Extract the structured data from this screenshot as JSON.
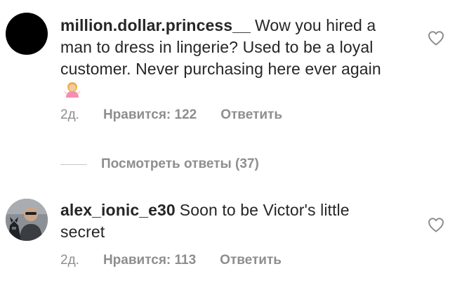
{
  "comments": [
    {
      "username": "million.dollar.princess__",
      "text": "Wow you hired a man to dress in lingerie? Used to be a loyal customer. Never purchasing here ever again",
      "emoji": "person-shrugging-emoji",
      "time": "2д.",
      "likes": "Нравится: 122",
      "reply": "Ответить"
    },
    {
      "username": "alex_ionic_e30",
      "text": "Soon to be Victor's little secret",
      "time": "2д.",
      "likes": "Нравится: 113",
      "reply": "Ответить"
    }
  ],
  "view_replies": {
    "label": "Посмотреть ответы (37)"
  },
  "colors": {
    "text": "#262626",
    "meta": "#8e8e8e",
    "divider": "#c7c7c7"
  },
  "icons": {
    "like": "heart-outline-icon"
  }
}
